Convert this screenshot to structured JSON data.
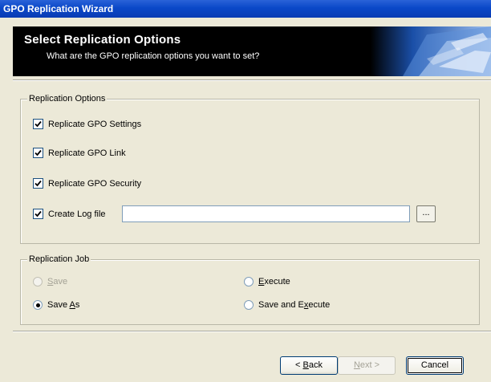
{
  "window": {
    "title": "GPO Replication Wizard"
  },
  "header": {
    "title": "Select Replication Options",
    "subtitle": "What are the GPO replication options you want to set?"
  },
  "replication_options": {
    "legend": "Replication Options",
    "items": [
      {
        "label": "Replicate GPO Settings",
        "checked": true
      },
      {
        "label": "Replicate GPO Link",
        "checked": true
      },
      {
        "label": "Replicate GPO Security",
        "checked": true
      },
      {
        "label": "Create Log file",
        "checked": true
      }
    ],
    "log_file_value": "",
    "browse_label": "..."
  },
  "replication_job": {
    "legend": "Replication Job",
    "options": [
      {
        "label": "Save",
        "accel": "S",
        "rest": "ave",
        "selected": false,
        "disabled": true
      },
      {
        "label": "Save As",
        "accel": "A",
        "selected": true,
        "disabled": false
      },
      {
        "label": "Execute",
        "accel": "E",
        "selected": false,
        "disabled": false
      },
      {
        "label": "Save and Execute",
        "selected": false,
        "disabled": false
      }
    ]
  },
  "buttons": {
    "back": "< Back",
    "next": "Next >",
    "cancel": "Cancel"
  },
  "colors": {
    "titlebar": "#0a48c8",
    "dialog_bg": "#ece9d8",
    "banner_bg": "#000000"
  }
}
